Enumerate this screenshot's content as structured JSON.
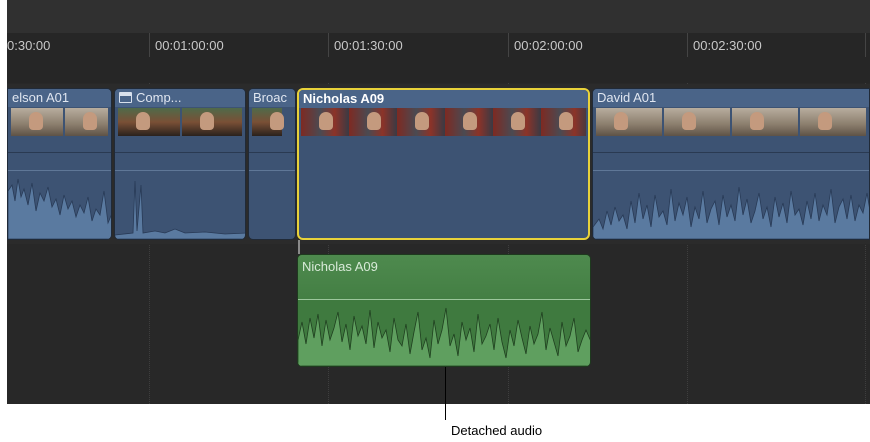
{
  "ruler": {
    "timecodes": [
      "0:30:00",
      "00:01:00:00",
      "00:01:30:00",
      "00:02:00:00",
      "00:02:30:00"
    ]
  },
  "clips": {
    "nelson": {
      "name": "elson A01"
    },
    "compound": {
      "name": "Comp...",
      "icon": "compound-clip-icon"
    },
    "broadcast": {
      "name": "Broac"
    },
    "nicholas_video": {
      "name": "Nicholas A09",
      "selected": true,
      "selection_color": "#e8d23a"
    },
    "david": {
      "name": "David A01"
    }
  },
  "detached_audio": {
    "name": "Nicholas A09",
    "color": "#3f7a3f"
  },
  "callout": {
    "label": "Detached audio"
  },
  "colors": {
    "clip_blue": "#3d5373",
    "audio_green": "#3f7a3f",
    "timeline_bg": "#282828"
  }
}
